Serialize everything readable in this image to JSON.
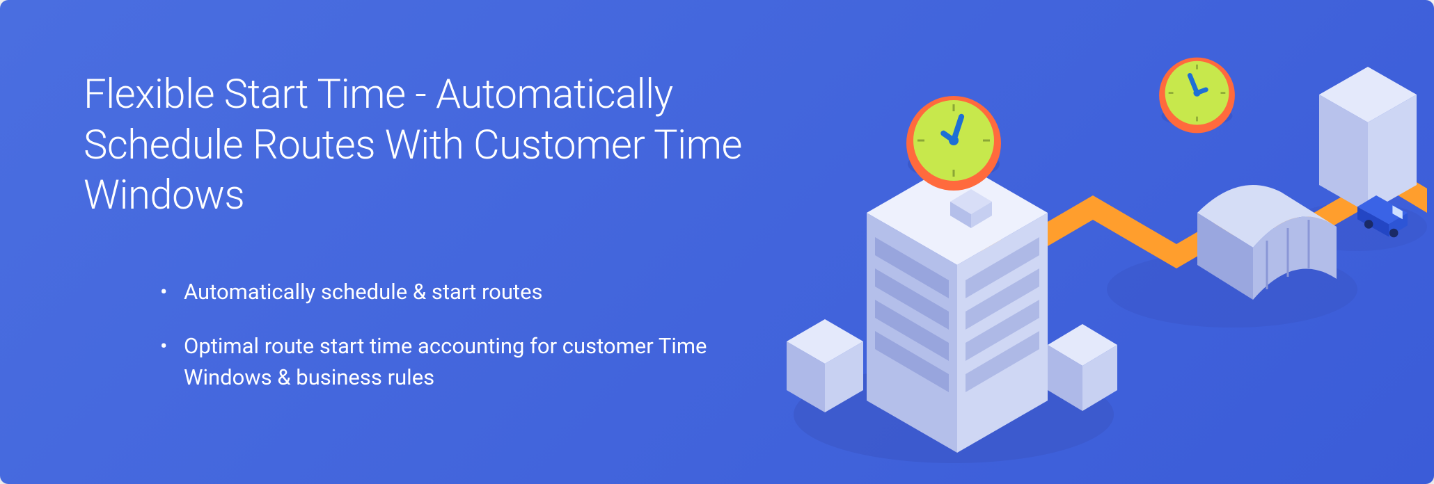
{
  "hero": {
    "headline": "Flexible Start Time - Automatically Schedule Routes With Customer Time Windows",
    "bullets": [
      "Automatically schedule & start routes",
      "Optimal route start time accounting for customer Time Windows & business rules"
    ]
  },
  "colors": {
    "bg_start": "#4a6ee0",
    "bg_end": "#3b5cd8",
    "text": "#ffffff",
    "route": "#ff9e2d",
    "clock_face": "#c7e84c",
    "clock_rim": "#ff6a3d",
    "building_light": "#d8dff7",
    "building_shadow": "#a8b4e6",
    "van": "#2d55d6"
  }
}
